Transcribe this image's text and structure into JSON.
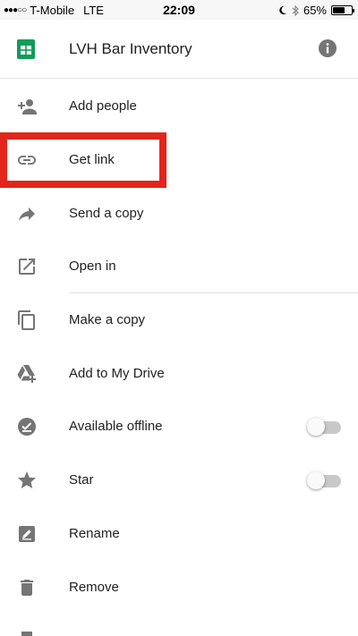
{
  "status_bar": {
    "signal": "●●●○○",
    "carrier": "T-Mobile",
    "network": "LTE",
    "time": "22:09",
    "battery_percent": "65%",
    "battery_level": 0.65
  },
  "header": {
    "title": "LVH Bar Inventory",
    "app_icon": "google-sheets-icon",
    "info_icon": "info-icon"
  },
  "menu": {
    "items": [
      {
        "label": "Add people",
        "icon": "add-person-icon"
      },
      {
        "label": "Get link",
        "icon": "link-icon"
      },
      {
        "label": "Send a copy",
        "icon": "share-arrow-icon"
      },
      {
        "label": "Open in",
        "icon": "open-in-new-icon"
      },
      {
        "label": "Make a copy",
        "icon": "copy-icon"
      },
      {
        "label": "Add to My Drive",
        "icon": "drive-add-icon"
      },
      {
        "label": "Available offline",
        "icon": "offline-check-icon",
        "toggle": "off"
      },
      {
        "label": "Star",
        "icon": "star-icon",
        "toggle": "off"
      },
      {
        "label": "Rename",
        "icon": "edit-icon"
      },
      {
        "label": "Remove",
        "icon": "trash-icon"
      }
    ]
  },
  "annotation": {
    "color": "#e3251b",
    "highlights": "Get link"
  },
  "colors": {
    "icon": "#757575",
    "sheets_green": "#0f9d58",
    "toggle_track": "#c8c8c8"
  }
}
